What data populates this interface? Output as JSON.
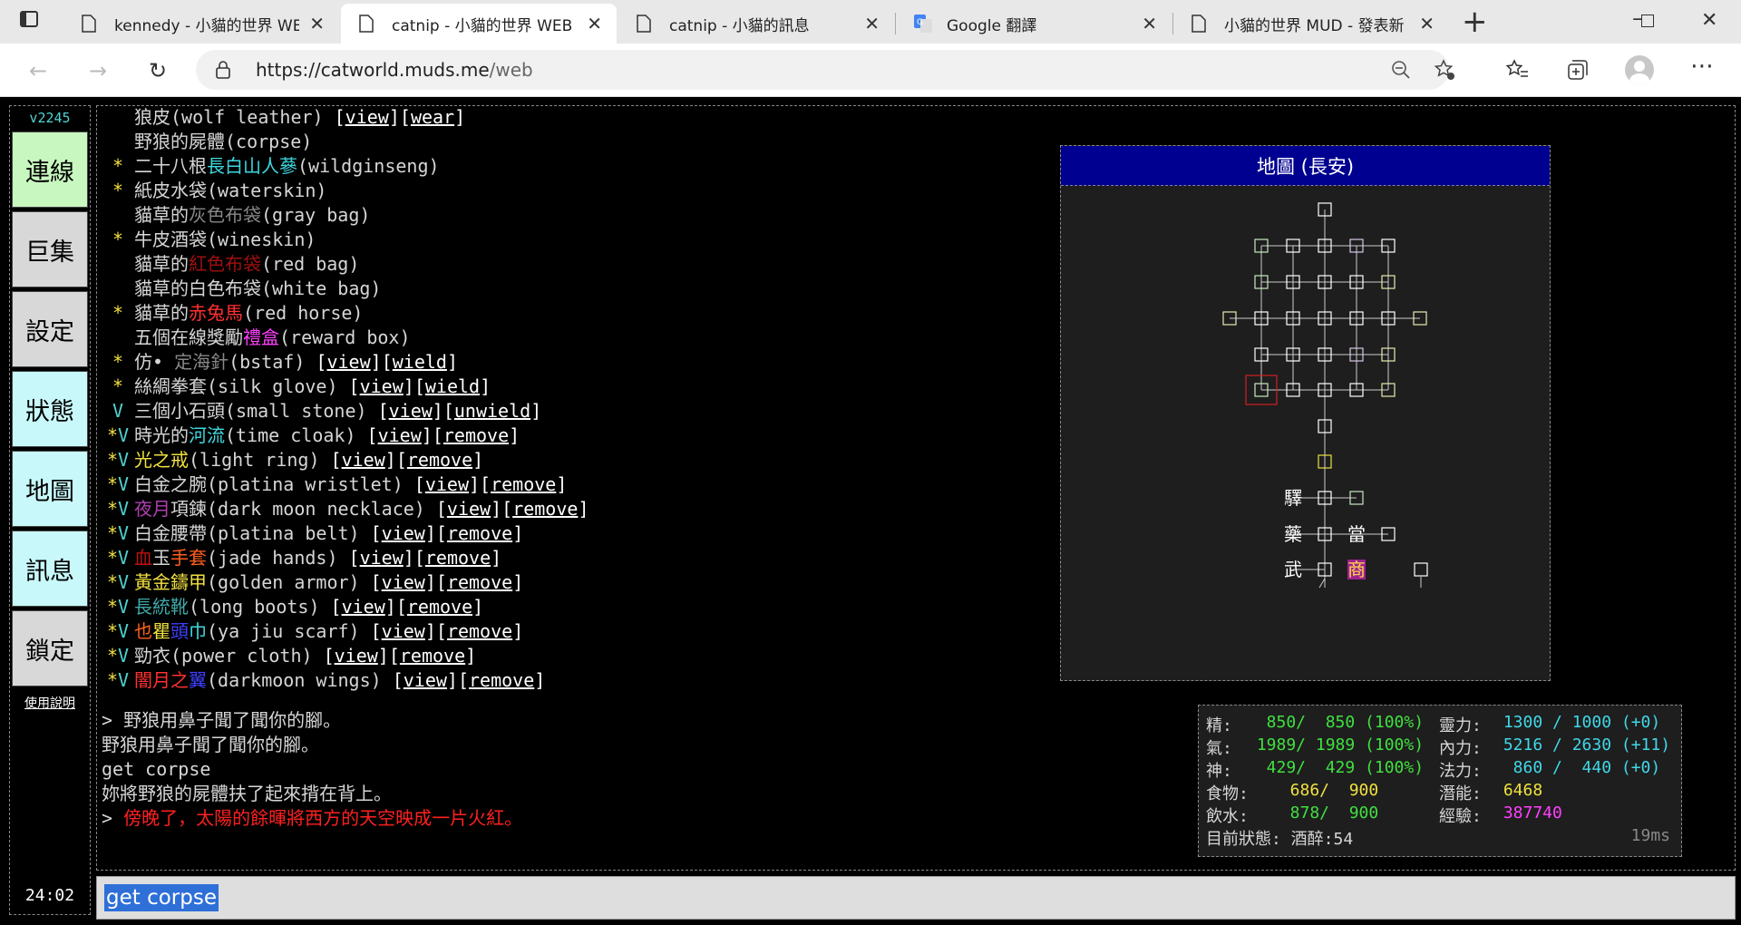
{
  "browser": {
    "tabs": [
      {
        "title": "kennedy - 小貓的世界 WE",
        "active": false
      },
      {
        "title": "catnip - 小貓的世界 WEB",
        "active": true
      },
      {
        "title": "catnip - 小貓的訊息",
        "active": false
      },
      {
        "title": "Google 翻譯",
        "active": false
      },
      {
        "title": "小貓的世界 MUD - 發表新",
        "active": false
      }
    ],
    "new_tab": "+",
    "url_host": "https://catworld.muds.me",
    "url_path": "/web",
    "window_controls": {
      "minimize": "–",
      "restore": "❐",
      "close": "✕"
    }
  },
  "sidebar": {
    "version": "v2245",
    "buttons": [
      {
        "label": "連線",
        "color": "#c8f8c0"
      },
      {
        "label": "巨集",
        "color": "#d8d8d8"
      },
      {
        "label": "設定",
        "color": "#d8d8d8"
      },
      {
        "label": "狀態",
        "color": "#c8f8fa"
      },
      {
        "label": "地圖",
        "color": "#c8f8fa"
      },
      {
        "label": "訊息",
        "color": "#c8f8fa"
      },
      {
        "label": "鎖定",
        "color": "#d8d8d8"
      }
    ],
    "help": "使用說明",
    "clock": "24:02"
  },
  "inventory": [
    {
      "mark": "",
      "parts": [
        {
          "t": "狼皮(wolf leather) "
        }
      ],
      "links": [
        "view",
        "wear"
      ]
    },
    {
      "mark": "",
      "parts": [
        {
          "t": "野狼的屍體(corpse)"
        }
      ],
      "links": []
    },
    {
      "mark": "*",
      "parts": [
        {
          "t": "二十八根"
        },
        {
          "t": "長白山人蔘",
          "c": "#3fd8e0"
        },
        {
          "t": "(wildginseng)"
        }
      ],
      "links": []
    },
    {
      "mark": "*",
      "parts": [
        {
          "t": "紙皮水袋(waterskin)"
        }
      ],
      "links": []
    },
    {
      "mark": "",
      "parts": [
        {
          "t": "貓草的"
        },
        {
          "t": "灰色布袋",
          "c": "#888888"
        },
        {
          "t": "(gray bag)"
        }
      ],
      "links": []
    },
    {
      "mark": "*",
      "parts": [
        {
          "t": "牛皮酒袋(wineskin)"
        }
      ],
      "links": []
    },
    {
      "mark": "",
      "parts": [
        {
          "t": "貓草的"
        },
        {
          "t": "紅色布袋",
          "c": "#a01010"
        },
        {
          "t": "(red bag)"
        }
      ],
      "links": []
    },
    {
      "mark": "",
      "parts": [
        {
          "t": "貓草的白色布袋(white bag)"
        }
      ],
      "links": []
    },
    {
      "mark": "*",
      "parts": [
        {
          "t": "貓草的"
        },
        {
          "t": "赤兔馬",
          "c": "#ff3030"
        },
        {
          "t": "(red horse)"
        }
      ],
      "links": []
    },
    {
      "mark": "",
      "parts": [
        {
          "t": "五個在線獎勵"
        },
        {
          "t": "禮盒",
          "c": "#ff40ff"
        },
        {
          "t": "(reward box)"
        }
      ],
      "links": []
    },
    {
      "mark": "*",
      "parts": [
        {
          "t": "仿• "
        },
        {
          "t": "定海針",
          "c": "#888888"
        },
        {
          "t": "(bstaf) "
        }
      ],
      "links": [
        "view",
        "wield"
      ]
    },
    {
      "mark": "*",
      "parts": [
        {
          "t": "絲綢拳套(silk glove) "
        }
      ],
      "links": [
        "view",
        "wield"
      ]
    },
    {
      "mark": "V",
      "parts": [
        {
          "t": "三個小石頭(small stone) "
        }
      ],
      "links": [
        "view",
        "unwield"
      ]
    },
    {
      "mark": "*V",
      "parts": [
        {
          "t": "時光的"
        },
        {
          "t": "河流",
          "c": "#3fd8e0"
        },
        {
          "t": "(time cloak) "
        }
      ],
      "links": [
        "view",
        "remove"
      ]
    },
    {
      "mark": "*V",
      "parts": [
        {
          "t": "光之戒",
          "c": "#f0e040"
        },
        {
          "t": "(light ring) "
        }
      ],
      "links": [
        "view",
        "remove"
      ]
    },
    {
      "mark": "*V",
      "parts": [
        {
          "t": "白金之腕(platina wristlet) "
        }
      ],
      "links": [
        "view",
        "remove"
      ]
    },
    {
      "mark": "*V",
      "parts": [
        {
          "t": "夜月",
          "c": "#b040b0"
        },
        {
          "t": "項鍊(dark moon necklace) "
        }
      ],
      "links": [
        "view",
        "remove"
      ]
    },
    {
      "mark": "*V",
      "parts": [
        {
          "t": "白金腰帶(platina belt) "
        }
      ],
      "links": [
        "view",
        "remove"
      ]
    },
    {
      "mark": "*V",
      "parts": [
        {
          "t": "血",
          "c": "#c01010"
        },
        {
          "t": "玉"
        },
        {
          "t": "手套",
          "c": "#ff6020"
        },
        {
          "t": "(jade hands) "
        }
      ],
      "links": [
        "view",
        "remove"
      ]
    },
    {
      "mark": "*V",
      "parts": [
        {
          "t": "黃金鑄甲",
          "c": "#f0e040"
        },
        {
          "t": "(golden armor) "
        }
      ],
      "links": [
        "view",
        "remove"
      ]
    },
    {
      "mark": "*V",
      "parts": [
        {
          "t": "長統靴",
          "c": "#3fa8a8"
        },
        {
          "t": "(long boots) "
        }
      ],
      "links": [
        "view",
        "remove"
      ]
    },
    {
      "mark": "*V",
      "parts": [
        {
          "t": "也",
          "c": "#ff6020"
        },
        {
          "t": "瞿",
          "c": "#f0e040"
        },
        {
          "t": "頭",
          "c": "#4040ff"
        },
        {
          "t": "巾",
          "c": "#3fd8e0"
        },
        {
          "t": "(ya jiu scarf) "
        }
      ],
      "links": [
        "view",
        "remove"
      ]
    },
    {
      "mark": "*V",
      "parts": [
        {
          "t": "勁衣(power cloth) "
        }
      ],
      "links": [
        "view",
        "remove"
      ]
    },
    {
      "mark": "*V",
      "parts": [
        {
          "t": "闇月",
          "c": "#ff3030"
        },
        {
          "t": "之",
          "c": "#ff3030"
        },
        {
          "t": "翼",
          "c": "#4040ff"
        },
        {
          "t": "(darkmoon wings) "
        }
      ],
      "links": [
        "view",
        "remove"
      ]
    }
  ],
  "messages": [
    {
      "t": "> 野狼用鼻子聞了聞你的腳。",
      "c": "#d6d6d6"
    },
    {
      "t": "野狼用鼻子聞了聞你的腳。",
      "c": "#d6d6d6"
    },
    {
      "t": "get corpse",
      "c": "#d6d6d6"
    },
    {
      "t": "妳將野狼的屍體扶了起來揹在背上。",
      "c": "#d6d6d6"
    },
    {
      "t": "> ",
      "c": "#d6d6d6",
      "t2": "傍晚了，太陽的餘暉將西方的天空映成一片火紅。",
      "c2": "#ff2020"
    }
  ],
  "map": {
    "title": "地圖 (長安)",
    "labels": {
      "station": "驛",
      "medicine": "藥",
      "pawn": "當",
      "martial": "武",
      "shop": "商"
    }
  },
  "stats": {
    "jing": {
      "label": "精:",
      "value": "  850/  850 (100%)"
    },
    "qi": {
      "label": "氣:",
      "value": " 1989/ 1989 (100%)"
    },
    "shen": {
      "label": "神:",
      "value": "  429/  429 (100%)"
    },
    "food": {
      "label": "食物:",
      "value": "  686/  900"
    },
    "water": {
      "label": "飲水:",
      "value": "  878/  900"
    },
    "lingli": {
      "label": "靈力:",
      "value": " 1300 / 1000 (+0)"
    },
    "neili": {
      "label": "內力:",
      "value": " 5216 / 2630 (+11)"
    },
    "fali": {
      "label": "法力:",
      "value": "  860 /  440 (+0)"
    },
    "potential": {
      "label": "潛能:",
      "value": " 6468"
    },
    "exp": {
      "label": "經驗:",
      "value": " 387740"
    },
    "status": "目前狀態: 酒醉:54",
    "latency": "19ms"
  },
  "command": {
    "value": "get corpse"
  }
}
